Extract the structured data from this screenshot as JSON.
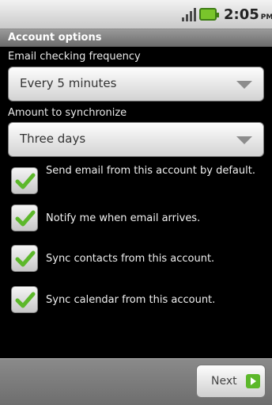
{
  "status_bar": {
    "time": "2:05",
    "ampm": "PM"
  },
  "title": "Account options",
  "frequency": {
    "label": "Email checking frequency",
    "value": "Every 5 minutes"
  },
  "sync_amount": {
    "label": "Amount to synchronize",
    "value": "Three days"
  },
  "options": [
    {
      "label": "Send email from this account by default.",
      "checked": true
    },
    {
      "label": "Notify me when email arrives.",
      "checked": true
    },
    {
      "label": "Sync contacts from this account.",
      "checked": true
    },
    {
      "label": "Sync calendar from this account.",
      "checked": true
    }
  ],
  "next_button": {
    "label": "Next",
    "icon": "next-arrow-icon"
  },
  "colors": {
    "check": "#5cb82a",
    "background": "#000000"
  }
}
